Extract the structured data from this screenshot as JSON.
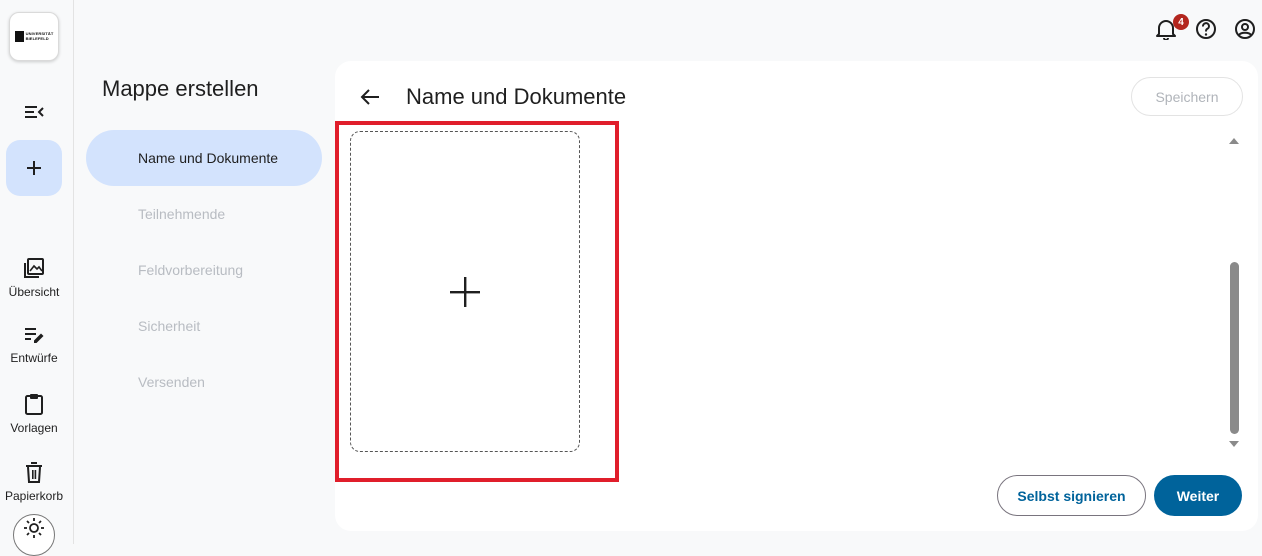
{
  "app": {
    "logo_text_line1": "UNIVERSITÄT",
    "logo_text_line2": "BIELEFELD",
    "notification_count": "4"
  },
  "rail": {
    "nav": [
      {
        "label": "Übersicht",
        "icon": "photo-library-icon"
      },
      {
        "label": "Entwürfe",
        "icon": "edit-list-icon"
      },
      {
        "label": "Vorlagen",
        "icon": "clipboard-icon"
      },
      {
        "label": "Papierkorb",
        "icon": "trash-icon"
      }
    ]
  },
  "stepper": {
    "title": "Mappe erstellen",
    "steps": [
      {
        "label": "Name und Dokumente",
        "active": true
      },
      {
        "label": "Teilnehmende",
        "active": false
      },
      {
        "label": "Feldvorbereitung",
        "active": false
      },
      {
        "label": "Sicherheit",
        "active": false
      },
      {
        "label": "Versenden",
        "active": false
      }
    ]
  },
  "main": {
    "title": "Name und Dokumente",
    "save_label": "Speichern",
    "self_sign_label": "Selbst signieren",
    "next_label": "Weiter"
  },
  "colors": {
    "primary": "#00639b",
    "active_step_bg": "#d3e3fd",
    "highlight_border": "#e01e2b",
    "badge": "#b3261e"
  }
}
